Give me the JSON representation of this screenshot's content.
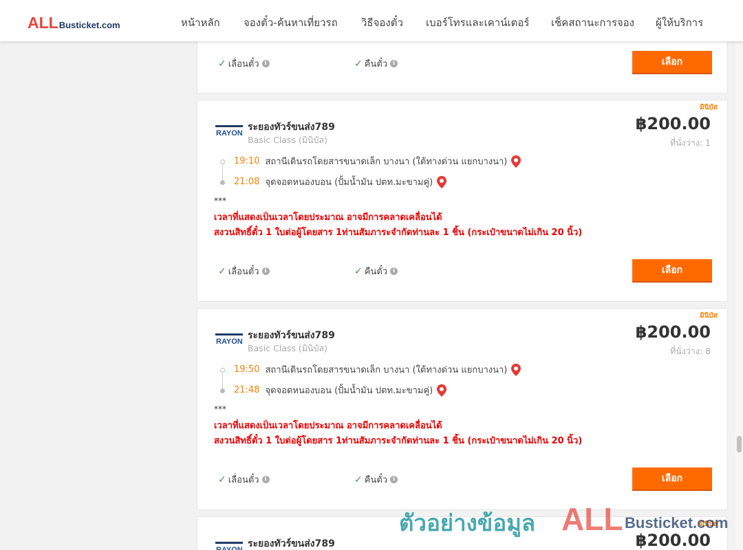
{
  "header": {
    "logo_all": "ALL",
    "logo_rest": "Busticket.com",
    "nav": [
      {
        "label": "หน้าหลัก"
      },
      {
        "label": "จองตั๋ว-ค้นหาเที่ยวรถ"
      },
      {
        "label": "วิธีจองตั๋ว"
      },
      {
        "label": "เบอร์โทรและเคาน์เตอร์"
      },
      {
        "label": "เช็คสถานะการจอง"
      },
      {
        "label": "ผู้ให้บริการ"
      }
    ]
  },
  "common": {
    "reschedule_label": "เลื่อนตั๋ว",
    "refund_label": "คืนตั๋ว",
    "select_label": "เลือก",
    "info_glyph": "i",
    "check_glyph": "✓",
    "logo_text": "RAYONG"
  },
  "results": [
    {
      "badge": "มินิบัส",
      "operator": "ระยองทัวร์ขนส่ง789",
      "bus_class": "Basic Class (มินิบัส)",
      "price": "฿200.00",
      "seats": "ที่นั่งว่าง: 1",
      "departure_time": "19:10",
      "departure_stop": "สถานีเดินรถโดยสารขนาดเล็ก บางนา (ใต้ทางด่วน แยกบางนา)",
      "arrival_time": "21:08",
      "arrival_stop": "จุดจอดหนองบอน (ปั้มน้ำมัน ปตท.มะขามคู่)",
      "note_stars": "***",
      "note_line1": "เวลาที่แสดงเป็นเวลาโดยประมาณ อาจมีการคลาดเคลื่อนได้",
      "note_line2": "สงวนสิทธิ์ตั๋ว 1 ใบต่อผู้โดยสาร 1ท่านสัมภาระจำกัดท่านละ 1 ชิ้น (กระเป๋าขนาดไม่เกิน 20 นิ้ว)"
    },
    {
      "badge": "มินิบัส",
      "operator": "ระยองทัวร์ขนส่ง789",
      "bus_class": "Basic Class (มินิบัส)",
      "price": "฿200.00",
      "seats": "ที่นั่งว่าง: 8",
      "departure_time": "19:50",
      "departure_stop": "สถานีเดินรถโดยสารขนาดเล็ก บางนา (ใต้ทางด่วน แยกบางนา)",
      "arrival_time": "21:48",
      "arrival_stop": "จุดจอดหนองบอน (ปั้มน้ำมัน ปตท.มะขามคู่)",
      "note_stars": "***",
      "note_line1": "เวลาที่แสดงเป็นเวลาโดยประมาณ อาจมีการคลาดเคลื่อนได้",
      "note_line2": "สงวนสิทธิ์ตั๋ว 1 ใบต่อผู้โดยสาร 1ท่านสัมภาระจำกัดท่านละ 1 ชิ้น (กระเป๋าขนาดไม่เกิน 20 นิ้ว)"
    },
    {
      "badge": "มินิบัส",
      "operator": "ระยองทัวร์ขนส่ง789",
      "price": "฿200.00"
    }
  ],
  "watermark": {
    "thai": "ตัวอย่างข้อมูล",
    "all": "ALL",
    "rest": "Busticket.com"
  },
  "colors": {
    "brand_red": "#e8453c",
    "brand_navy": "#1f3b66",
    "accent_orange": "#ff6a00",
    "time_orange": "#ff7f00",
    "warning_red": "#e00000",
    "check_green": "#3a9a3a",
    "pin_red": "#e53935"
  }
}
